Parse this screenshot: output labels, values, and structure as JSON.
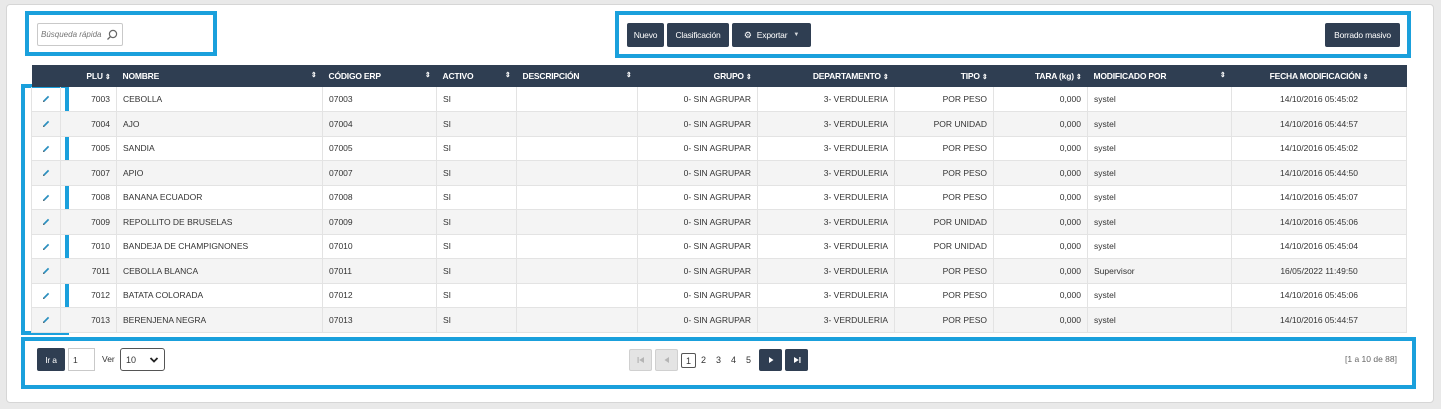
{
  "search": {
    "placeholder": "Búsqueda rápida",
    "icon": "search-icon"
  },
  "toolbar": {
    "nuevo": "Nuevo",
    "clasificacion": "Clasificación",
    "exportar": "Exportar",
    "borrado_masivo": "Borrado masivo"
  },
  "table": {
    "headers": {
      "plu": "PLU",
      "nombre": "NOMBRE",
      "codigo_erp": "CÓDIGO ERP",
      "activo": "ACTIVO",
      "descripcion": "DESCRIPCIÓN",
      "grupo": "GRUPO",
      "departamento": "DEPARTAMENTO",
      "tipo": "TIPO",
      "tara": "TARA (kg)",
      "modificado_por": "MODIFICADO POR",
      "fecha_modificacion": "FECHA MODIFICACIÓN"
    },
    "rows": [
      {
        "plu": "7003",
        "nombre": "CEBOLLA",
        "erp": "07003",
        "activo": "SI",
        "descripcion": "",
        "grupo": "0- SIN AGRUPAR",
        "departamento": "3- VERDULERIA",
        "tipo": "POR PESO",
        "tara": "0,000",
        "modificado": "systel",
        "fecha": "14/10/2016 05:45:02"
      },
      {
        "plu": "7004",
        "nombre": "AJO",
        "erp": "07004",
        "activo": "SI",
        "descripcion": "",
        "grupo": "0- SIN AGRUPAR",
        "departamento": "3- VERDULERIA",
        "tipo": "POR UNIDAD",
        "tara": "0,000",
        "modificado": "systel",
        "fecha": "14/10/2016 05:44:57"
      },
      {
        "plu": "7005",
        "nombre": "SANDIA",
        "erp": "07005",
        "activo": "SI",
        "descripcion": "",
        "grupo": "0- SIN AGRUPAR",
        "departamento": "3- VERDULERIA",
        "tipo": "POR PESO",
        "tara": "0,000",
        "modificado": "systel",
        "fecha": "14/10/2016 05:45:02"
      },
      {
        "plu": "7007",
        "nombre": "APIO",
        "erp": "07007",
        "activo": "SI",
        "descripcion": "",
        "grupo": "0- SIN AGRUPAR",
        "departamento": "3- VERDULERIA",
        "tipo": "POR PESO",
        "tara": "0,000",
        "modificado": "systel",
        "fecha": "14/10/2016 05:44:50"
      },
      {
        "plu": "7008",
        "nombre": "BANANA ECUADOR",
        "erp": "07008",
        "activo": "SI",
        "descripcion": "",
        "grupo": "0- SIN AGRUPAR",
        "departamento": "3- VERDULERIA",
        "tipo": "POR PESO",
        "tara": "0,000",
        "modificado": "systel",
        "fecha": "14/10/2016 05:45:07"
      },
      {
        "plu": "7009",
        "nombre": "REPOLLITO DE BRUSELAS",
        "erp": "07009",
        "activo": "SI",
        "descripcion": "",
        "grupo": "0- SIN AGRUPAR",
        "departamento": "3- VERDULERIA",
        "tipo": "POR UNIDAD",
        "tara": "0,000",
        "modificado": "systel",
        "fecha": "14/10/2016 05:45:06"
      },
      {
        "plu": "7010",
        "nombre": "BANDEJA DE CHAMPIGNONES",
        "erp": "07010",
        "activo": "SI",
        "descripcion": "",
        "grupo": "0- SIN AGRUPAR",
        "departamento": "3- VERDULERIA",
        "tipo": "POR UNIDAD",
        "tara": "0,000",
        "modificado": "systel",
        "fecha": "14/10/2016 05:45:04"
      },
      {
        "plu": "7011",
        "nombre": "CEBOLLA BLANCA",
        "erp": "07011",
        "activo": "SI",
        "descripcion": "",
        "grupo": "0- SIN AGRUPAR",
        "departamento": "3- VERDULERIA",
        "tipo": "POR PESO",
        "tara": "0,000",
        "modificado": "Supervisor",
        "fecha": "16/05/2022 11:49:50"
      },
      {
        "plu": "7012",
        "nombre": "BATATA COLORADA",
        "erp": "07012",
        "activo": "SI",
        "descripcion": "",
        "grupo": "0- SIN AGRUPAR",
        "departamento": "3- VERDULERIA",
        "tipo": "POR PESO",
        "tara": "0,000",
        "modificado": "systel",
        "fecha": "14/10/2016 05:45:06"
      },
      {
        "plu": "7013",
        "nombre": "BERENJENA NEGRA",
        "erp": "07013",
        "activo": "SI",
        "descripcion": "",
        "grupo": "0- SIN AGRUPAR",
        "departamento": "3- VERDULERIA",
        "tipo": "POR PESO",
        "tara": "0,000",
        "modificado": "systel",
        "fecha": "14/10/2016 05:44:57"
      }
    ]
  },
  "footer": {
    "goto_label": "Ir a",
    "goto_value": "1",
    "ver_label": "Ver",
    "page_size": "10",
    "pages": [
      "1",
      "2",
      "3",
      "4",
      "5"
    ],
    "current_page": "1",
    "count_text": "[1 a 10 de 88]"
  },
  "colors": {
    "accent_highlight": "#1aa0dc",
    "button_dark": "#2f3e52",
    "edit_icon": "#2a8fbf"
  }
}
